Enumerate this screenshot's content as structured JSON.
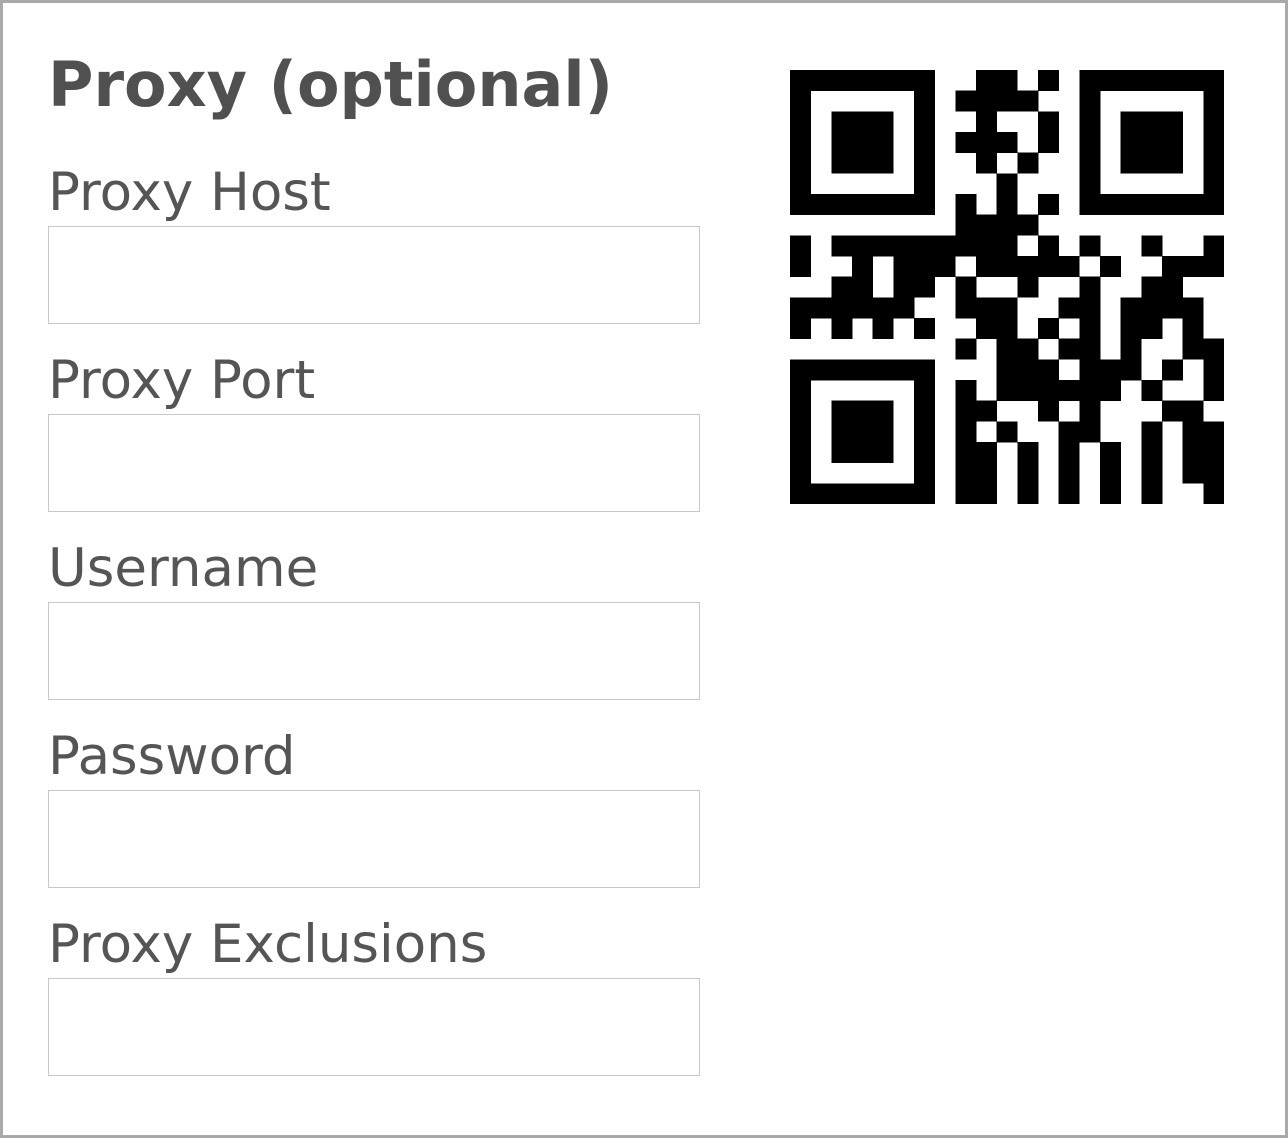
{
  "form": {
    "title": "Proxy (optional)",
    "fields": [
      {
        "label": "Proxy Host",
        "value": "",
        "placeholder": ""
      },
      {
        "label": "Proxy Port",
        "value": "",
        "placeholder": ""
      },
      {
        "label": "Username",
        "value": "",
        "placeholder": ""
      },
      {
        "label": "Password",
        "value": "",
        "placeholder": ""
      },
      {
        "label": "Proxy Exclusions",
        "value": "",
        "placeholder": ""
      }
    ]
  },
  "qr_code": {
    "icon": "qr-code-icon",
    "color": "#000000",
    "matrix": [
      "111111100110101111111",
      "100000101111001000001",
      "101110100100101011101",
      "101110101110101011101",
      "101110100101001011101",
      "100000100010001000001",
      "111111101010101111111",
      "000000001111000000000",
      "101111111110101001001",
      "100101110111110100111",
      "001101101001001001100",
      "111111001110011011110",
      "101010100110101011010",
      "000000001011011010011",
      "111111100011101110101",
      "100000101011111101001",
      "101110101100101000110",
      "101110101010011001011",
      "101110101101010101011",
      "100000101101010101011",
      "111111101101010101001"
    ]
  }
}
